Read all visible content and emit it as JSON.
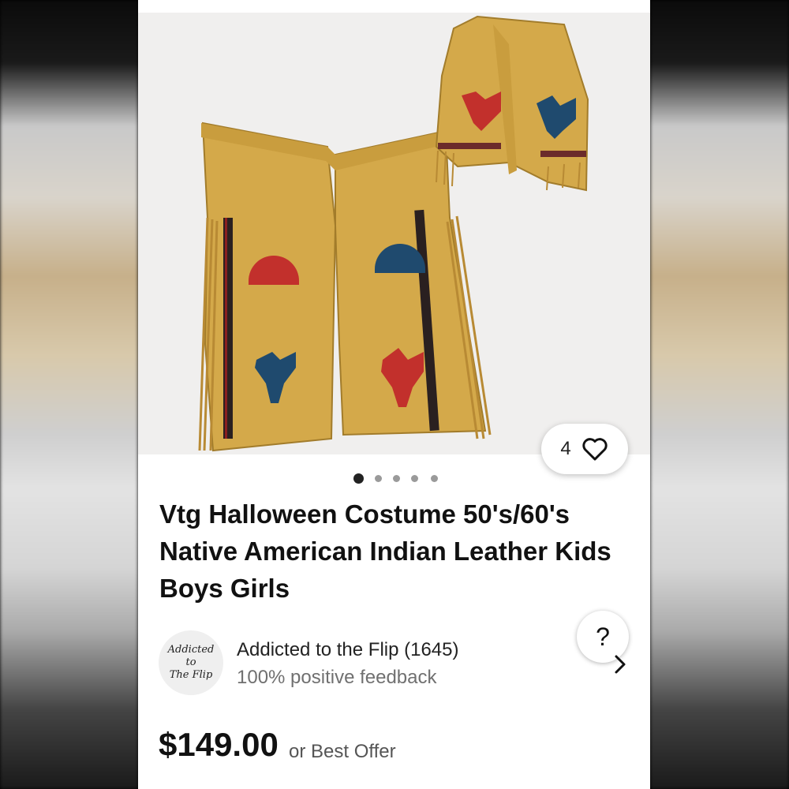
{
  "listing": {
    "title": "Vtg Halloween Costume 50's/60's Native American Indian Leather Kids Boys Girls",
    "image_alt": "Tan suede fringed chaps and vest with red and blue thunderbird patches",
    "watchers_count": "4",
    "carousel": {
      "total": 5,
      "active_index": 0
    }
  },
  "help": {
    "label": "?"
  },
  "seller": {
    "logo_lines": [
      "Addicted",
      "to",
      "The Flip"
    ],
    "name": "Addicted to the Flip (1645)",
    "feedback": "100% positive feedback"
  },
  "pricing": {
    "price": "$149.00",
    "offer_label": "or Best Offer"
  },
  "icons": {
    "heart": "heart-icon",
    "help": "question-icon",
    "chevron": "chevron-right-icon"
  },
  "colors": {
    "suede": "#d4a94a",
    "thunderbird_red": "#c2302c",
    "thunderbird_blue": "#1f4a6e"
  }
}
